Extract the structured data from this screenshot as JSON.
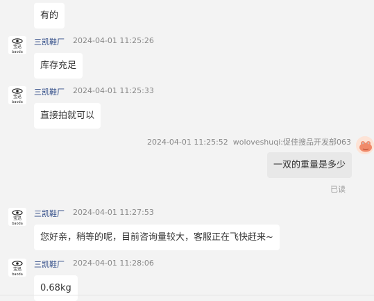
{
  "messages": [
    {
      "direction": "in",
      "text": "有的"
    },
    {
      "direction": "in",
      "sender": "三凯鞋厂",
      "time": "2024-04-01 11:25:26",
      "text": "库存充足"
    },
    {
      "direction": "in",
      "sender": "三凯鞋厂",
      "time": "2024-04-01 11:25:33",
      "text": "直接拍就可以"
    },
    {
      "direction": "out",
      "sender": "woloveshuqi:促佳搜品开发部063",
      "time": "2024-04-01 11:25:52",
      "text": "一双的重量是多少",
      "status": "已读"
    },
    {
      "direction": "in",
      "sender": "三凯鞋厂",
      "time": "2024-04-01 11:27:53",
      "text": "您好亲，稍等的呢，目前咨询量较大，客服正在飞快赶来~"
    },
    {
      "direction": "in",
      "sender": "三凯鞋厂",
      "time": "2024-04-01 11:28:06",
      "text": "0.68kg"
    }
  ],
  "shop_avatar": {
    "icon": "shop-logo-eye-icon",
    "text": "宝迅",
    "sub": "baoda"
  },
  "user_avatar": {
    "icon": "cartoon-crab-avatar-icon"
  },
  "colors": {
    "background": "#f3f3f3",
    "bubble_in": "#ffffff",
    "bubble_out": "#e8e8e8",
    "sender_name": "#2e4a86",
    "meta": "#888888"
  }
}
